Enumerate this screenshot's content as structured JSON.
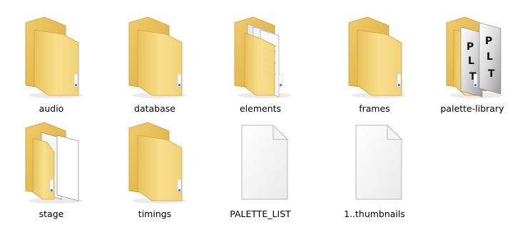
{
  "explorer": {
    "view_mode": "large-icons",
    "items": [
      {
        "label": "audio",
        "type": "folder",
        "icon": "folder-icon",
        "preview": "empty"
      },
      {
        "label": "database",
        "type": "folder",
        "icon": "folder-icon",
        "preview": "empty"
      },
      {
        "label": "elements",
        "type": "folder",
        "icon": "folder-icon",
        "preview": "documents"
      },
      {
        "label": "frames",
        "type": "folder",
        "icon": "folder-icon",
        "preview": "empty"
      },
      {
        "label": "palette-library",
        "type": "folder",
        "icon": "folder-icon",
        "preview": "plt-files",
        "preview_text": "PLT"
      },
      {
        "label": "stage",
        "type": "folder",
        "icon": "folder-icon",
        "preview": "blank-pages"
      },
      {
        "label": "timings",
        "type": "folder",
        "icon": "folder-icon",
        "preview": "empty"
      },
      {
        "label": "PALETTE_LIST",
        "type": "file",
        "icon": "file-icon"
      },
      {
        "label": "1..thumbnails",
        "type": "file",
        "icon": "file-icon"
      }
    ]
  },
  "colors": {
    "folder_back": "#e2b54a",
    "folder_front": "#f5d984",
    "folder_edge": "#c99a2e",
    "file_page": "#f7f7f7",
    "file_border": "#b9b9b9",
    "background": "#ffffff"
  }
}
